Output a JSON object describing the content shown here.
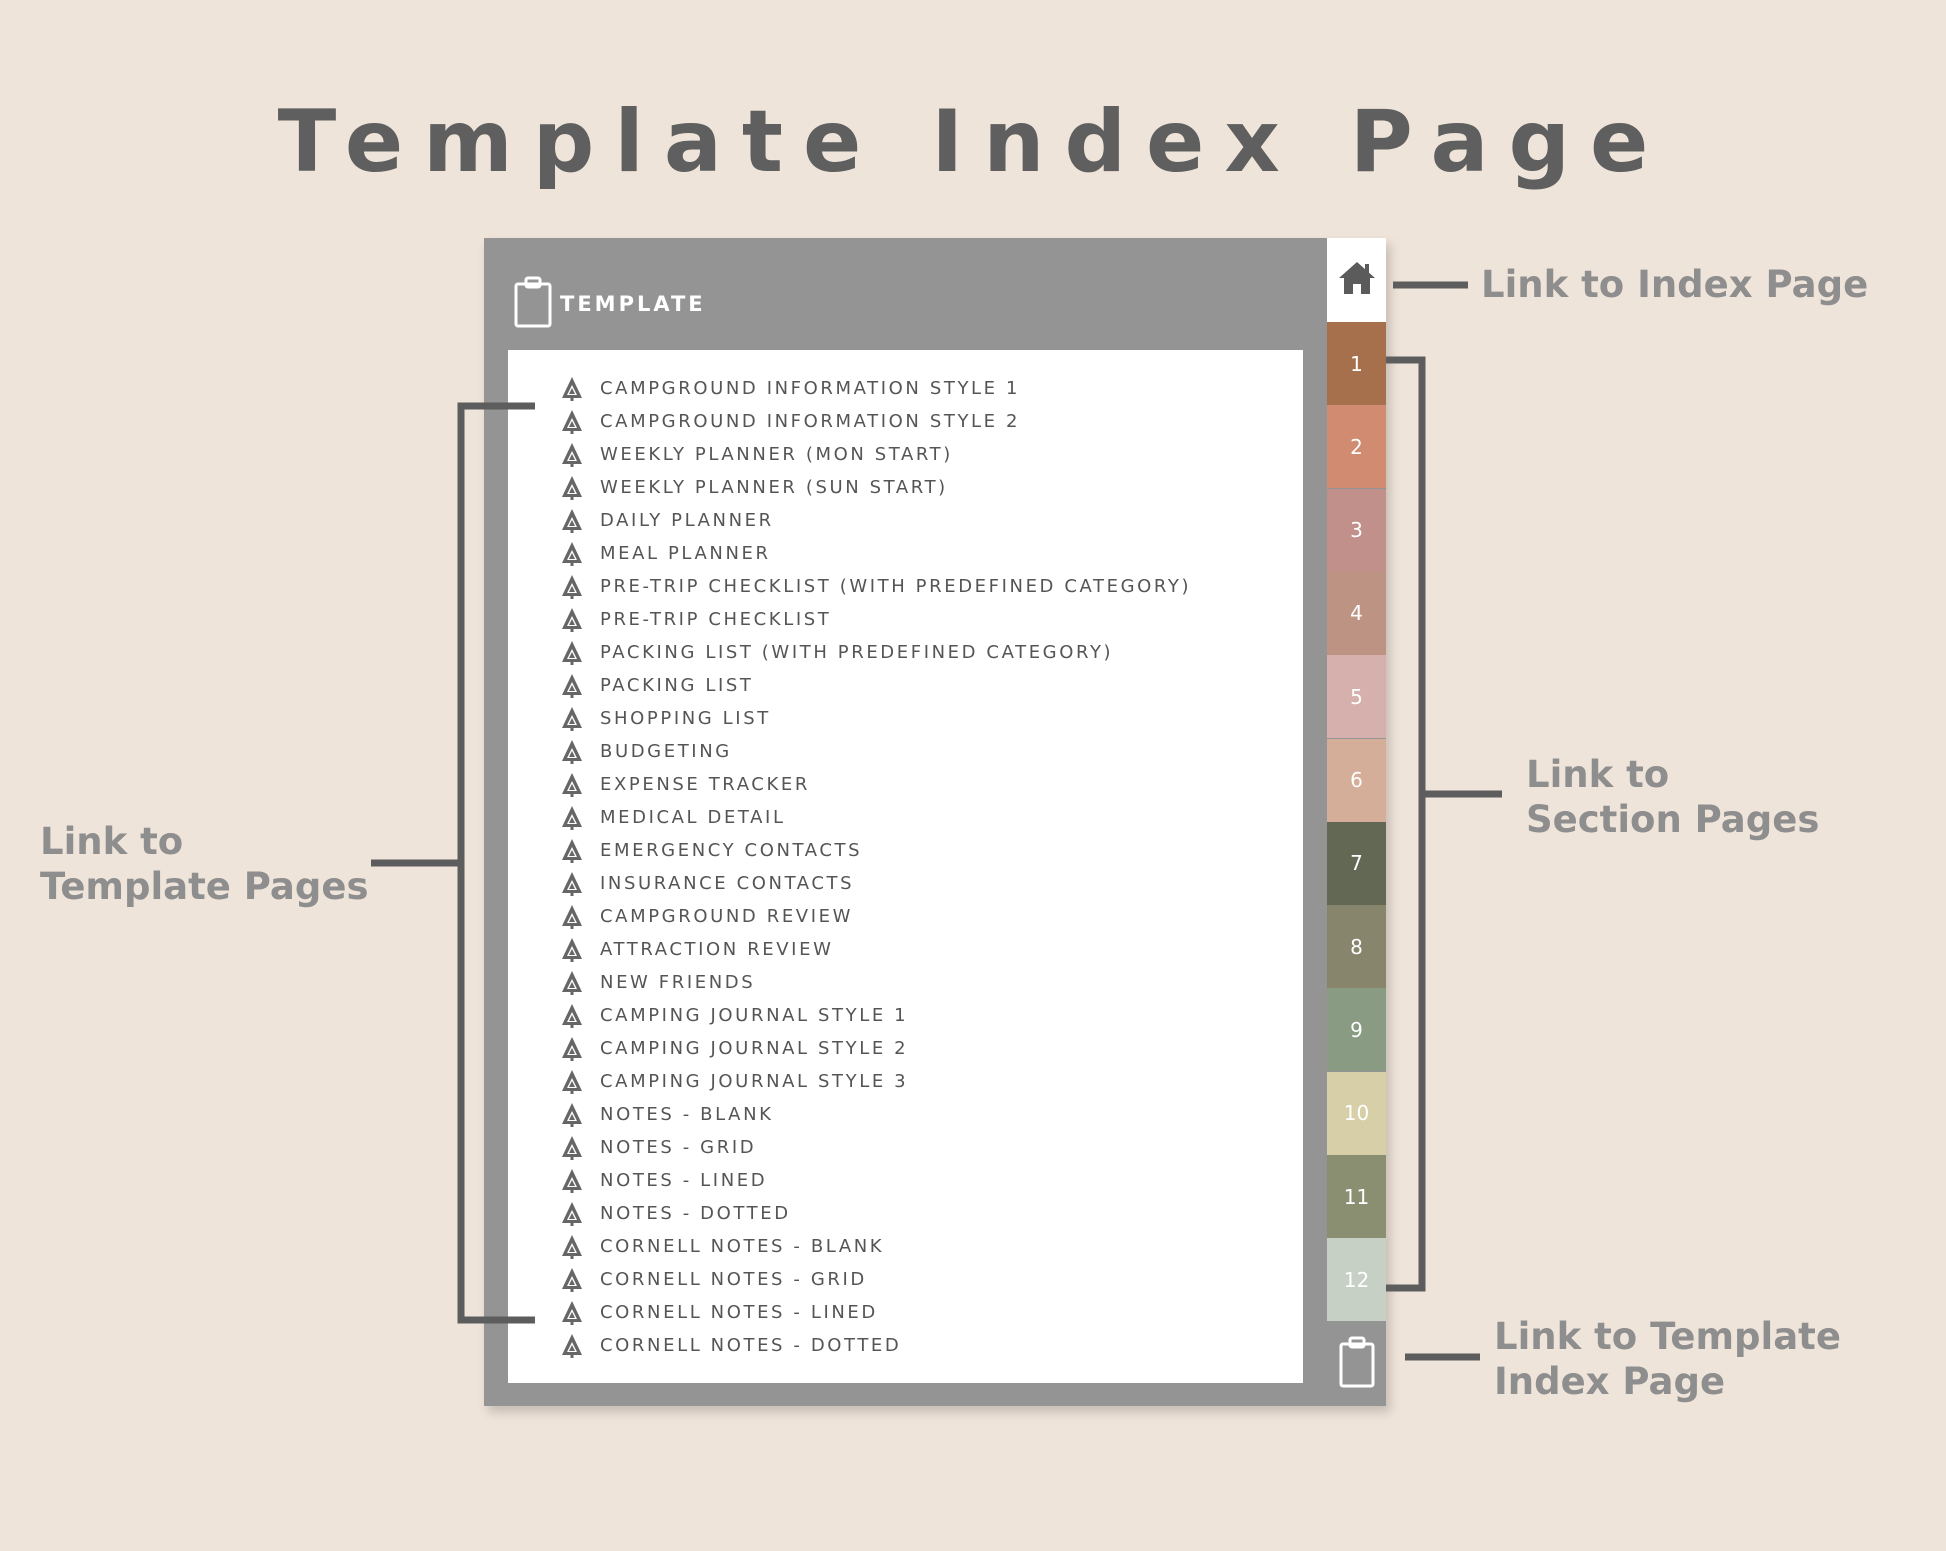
{
  "page": {
    "title": "Template Index Page"
  },
  "header": {
    "label": "TEMPLATE",
    "icon": "clipboard-icon"
  },
  "template_list": [
    "CAMPGROUND INFORMATION STYLE 1",
    "CAMPGROUND INFORMATION STYLE 2",
    "WEEKLY PLANNER (MON START)",
    "WEEKLY PLANNER (SUN START)",
    "DAILY PLANNER",
    "MEAL PLANNER",
    "PRE-TRIP CHECKLIST (WITH PREDEFINED CATEGORY)",
    "PRE-TRIP CHECKLIST",
    "PACKING LIST (WITH PREDEFINED CATEGORY)",
    "PACKING LIST",
    "SHOPPING LIST",
    "BUDGETING",
    "EXPENSE TRACKER",
    "MEDICAL DETAIL",
    "EMERGENCY CONTACTS",
    "INSURANCE CONTACTS",
    "CAMPGROUND REVIEW",
    "ATTRACTION REVIEW",
    "NEW FRIENDS",
    "CAMPING JOURNAL STYLE 1",
    "CAMPING JOURNAL STYLE 2",
    "CAMPING JOURNAL STYLE 3",
    "NOTES - BLANK",
    "NOTES - GRID",
    "NOTES - LINED",
    "NOTES - DOTTED",
    "CORNELL NOTES - BLANK",
    "CORNELL NOTES - GRID",
    "CORNELL NOTES - LINED",
    "CORNELL NOTES - DOTTED"
  ],
  "list_item_icon": "pine-tree-icon",
  "tabs": {
    "home_icon": "home-icon",
    "template_icon": "clipboard-icon",
    "sections": [
      {
        "label": "1",
        "color": "#a7704c"
      },
      {
        "label": "2",
        "color": "#d08b70"
      },
      {
        "label": "3",
        "color": "#c1908a"
      },
      {
        "label": "4",
        "color": "#bd9384"
      },
      {
        "label": "5",
        "color": "#d5b0ac"
      },
      {
        "label": "6",
        "color": "#d4ae98"
      },
      {
        "label": "7",
        "color": "#626853"
      },
      {
        "label": "8",
        "color": "#87856c"
      },
      {
        "label": "9",
        "color": "#8a9b84"
      },
      {
        "label": "10",
        "color": "#d6cfa8"
      },
      {
        "label": "11",
        "color": "#8b8f72"
      },
      {
        "label": "12",
        "color": "#c6d0c4"
      }
    ]
  },
  "callouts": {
    "index_page": "Link to Index Page",
    "section_pages": [
      "Link to",
      "Section Pages"
    ],
    "template_pages": [
      "Link to",
      "Template Pages"
    ],
    "template_index_page": [
      "Link to Template",
      "Index Page"
    ]
  },
  "colors": {
    "background": "#efe4da",
    "device_frame": "#949494",
    "bracket": "#5d5d5d",
    "callout_text": "#8e8e8e",
    "title_text": "#5f5f5f"
  }
}
